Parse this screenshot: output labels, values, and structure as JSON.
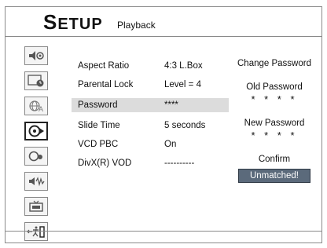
{
  "header": {
    "title_first": "S",
    "title_rest": "ETUP",
    "section": "Playback"
  },
  "sidebar": {
    "items": [
      {
        "icon": "speaker-eye-icon",
        "active": false
      },
      {
        "icon": "clock-box-icon",
        "active": false
      },
      {
        "icon": "globe-language-icon",
        "active": false
      },
      {
        "icon": "playback-disc-icon",
        "active": true
      },
      {
        "icon": "screen-ratio-icon",
        "active": false
      },
      {
        "icon": "audio-speaker-icon",
        "active": false
      },
      {
        "icon": "tv-icon",
        "active": false
      },
      {
        "icon": "exit-icon",
        "active": false
      }
    ]
  },
  "menu": {
    "rows": [
      {
        "label": "Aspect Ratio",
        "value": "4:3 L.Box"
      },
      {
        "label": "Parental Lock",
        "value": "Level = 4"
      },
      {
        "label": "Password",
        "value": "****",
        "selected": true
      },
      {
        "label": "Slide Time",
        "value": "5 seconds"
      },
      {
        "label": "VCD PBC",
        "value": "On"
      },
      {
        "label": "DivX(R) VOD",
        "value": "----------"
      }
    ]
  },
  "password_panel": {
    "title": "Change Password",
    "old_label": "Old Password",
    "old_value": "* * * *",
    "new_label": "New Password",
    "new_value": "* * * *",
    "confirm_label": "Confirm",
    "confirm_status": "Unmatched!"
  },
  "colors": {
    "selected_row": "#dcdcdc",
    "badge": "#5b6a7b"
  }
}
